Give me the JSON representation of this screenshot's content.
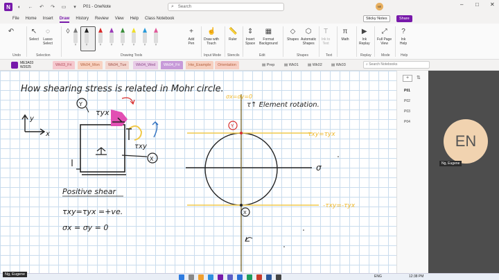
{
  "titlebar": {
    "doc_title": "P01 - OneNote",
    "app_letter": "N",
    "search_placeholder": "Search",
    "avatar_initials": "NE",
    "minimize": "–",
    "restore": "□",
    "close": "✕"
  },
  "menu": {
    "items": [
      "File",
      "Home",
      "Insert",
      "Draw",
      "History",
      "Review",
      "View",
      "Help",
      "Class Notebook"
    ],
    "active": "Draw",
    "sticky_notes": "Sticky Notes",
    "share": "Share"
  },
  "ribbon": {
    "undo": "Undo",
    "select": "Select",
    "lasso": "Lasso\nSelect",
    "selection_group": "Selection",
    "drawing_tools_group": "Drawing Tools",
    "pens": [
      {
        "color": "#7a7a7a"
      },
      {
        "color": "#222222"
      },
      {
        "color": "#d92b2b"
      },
      {
        "color": "#9b3bb8"
      },
      {
        "color": "#3b8f3b"
      },
      {
        "color": "#f0e02a"
      },
      {
        "color": "#2a9bd9"
      },
      {
        "color": "#e05a9a"
      }
    ],
    "add_pen": "Add\nPen",
    "draw_with_touch": "Draw with\nTouch",
    "input_mode_group": "Input Mode",
    "ruler": "Ruler",
    "stencils_group": "Stencils",
    "insert_space": "Insert\nSpace",
    "format_background": "Format\nBackground",
    "edit_group": "Edit",
    "shapes": "Shapes",
    "automatic_shapes": "Automatic\nShapes",
    "shapes_group": "Shapes",
    "ink_to_text": "Ink to\nText",
    "text_group": "Text",
    "math": "Math",
    "math_group": "",
    "ink_replay": "Ink\nReplay",
    "replay_group": "Replay",
    "full_page_view": "Full Page\nView",
    "mode_group": "Mode",
    "ink_help": "Ink\nHelp",
    "help_group": "Help"
  },
  "notebook": {
    "name": "ME3A03",
    "term": "W2025"
  },
  "section_tabs": [
    {
      "label": "Wk03_Fri",
      "color": "#f6c9cf",
      "text": "#b04a5a"
    },
    {
      "label": "Wk04_Mon",
      "color": "#f8d3c2",
      "text": "#b4603c"
    },
    {
      "label": "Wk04_Tue",
      "color": "#f3d6cf",
      "text": "#a05046"
    },
    {
      "label": "Wk04_Wed",
      "color": "#e9cde8",
      "text": "#8c4a8a"
    },
    {
      "label": "Wk04_Fri",
      "color": "#c79ad9",
      "text": "#ffffff"
    },
    {
      "label": "Hw_Example",
      "color": "#f6d0c0",
      "text": "#b4603c"
    },
    {
      "label": "Orientation",
      "color": "#f7cfc4",
      "text": "#b4603c"
    }
  ],
  "section_groups": [
    "Prep",
    "Wk01",
    "Wk02",
    "Wk03"
  ],
  "notebook_search": "Search Notebooks",
  "pages": [
    "P01",
    "P02",
    "P03",
    "P04"
  ],
  "active_page": "P01",
  "handwriting": {
    "title": "How shearing stress is related in Mohr circle.",
    "axis_y": "y",
    "axis_x": "x",
    "tau_yx_label": "τyx",
    "tau_xy_label": "τxy",
    "element_rotation": "τ↑ Element rotation.",
    "top_axis_note": "σx=σy=0",
    "y_circle": "Y",
    "x_circle": "X",
    "sigma_axis": "σ",
    "tau_top": "τxy=τyx",
    "tau_bottom": "-τxy=-τyx",
    "positive_shear": "Positive shear",
    "eq1": "τxy=τyx =+ve.",
    "eq2": "σx = σy = 0"
  },
  "participant": {
    "initials": "EN",
    "name": "Ng, Eugene"
  },
  "presenter_label": "Ng, Eugene",
  "taskbar": {
    "lang": "ENG",
    "time": "12:38 PM"
  }
}
